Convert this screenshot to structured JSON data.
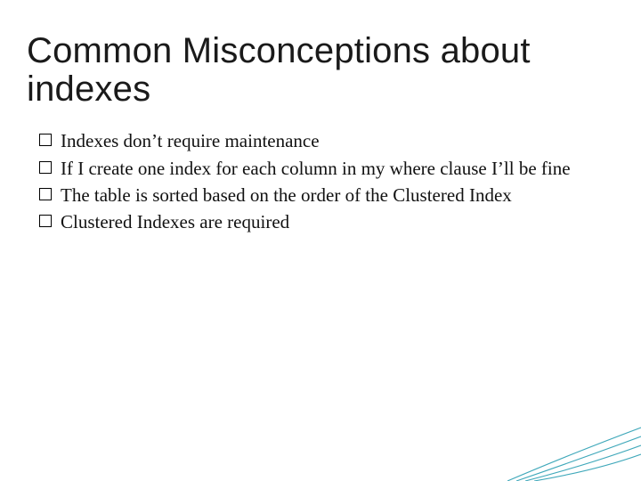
{
  "title": "Common Misconceptions about indexes",
  "bullets": [
    "Indexes don’t require maintenance",
    "If I create one index for each column in my where clause I’ll be fine",
    "The table is sorted based on the order of the Clustered Index",
    "Clustered Indexes are required"
  ]
}
